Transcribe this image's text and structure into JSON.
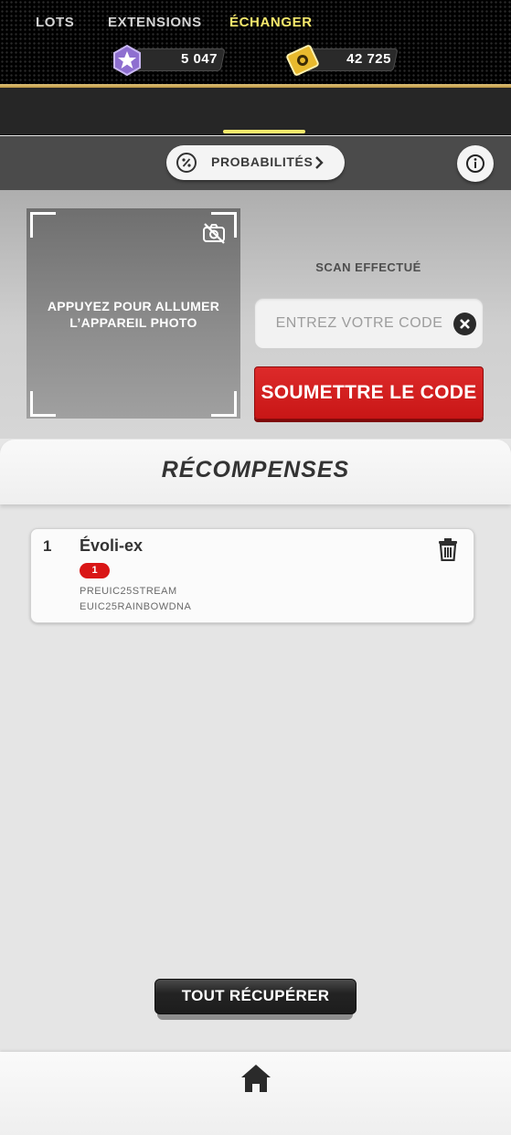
{
  "currencies": [
    {
      "icon": "star-hexagon-icon",
      "value": "5 047",
      "color": "#8e6fd0"
    },
    {
      "icon": "ticket-icon",
      "value": "42 725",
      "color": "#e8b92e"
    }
  ],
  "tabs": [
    {
      "label": "LOTS",
      "active": false
    },
    {
      "label": "EXTENSIONS",
      "active": false
    },
    {
      "label": "ÉCHANGER",
      "active": true
    }
  ],
  "probabilities_label": "PROBABILITÉS",
  "camera_prompt": "APPUYEZ POUR ALLUMER L’APPAREIL PHOTO",
  "scan_status": "SCAN EFFECTUÉ",
  "code_placeholder": "ENTREZ VOTRE CODE",
  "submit_label": "SOUMETTRE LE CODE",
  "rewards": {
    "title": "RÉCOMPENSES",
    "items": [
      {
        "index": "1",
        "name": "Évoli-ex",
        "count": "1",
        "codes": [
          "PREUIC25STREAM",
          "EUIC25RAINBOWDNA"
        ]
      }
    ],
    "collect_label": "TOUT RÉCUPÉRER"
  },
  "colors": {
    "accent": "#f6e96c",
    "submit_red": "#d41f1f",
    "badge_red": "#d91616"
  }
}
